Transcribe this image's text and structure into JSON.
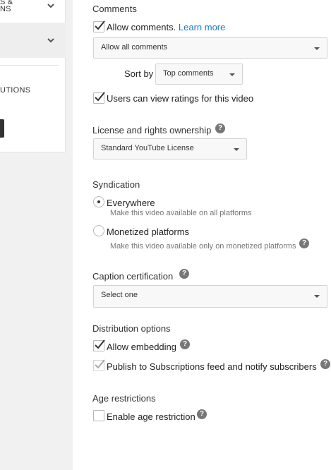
{
  "sidebar": {
    "row1_text_line1": "S &",
    "row1_text_line2": "NS",
    "contributions_label": "UTIONS",
    "icons": [
      "chevron-down-icon",
      "chevron-down-icon"
    ]
  },
  "comments": {
    "title": "Comments",
    "allow_label": "Allow comments.",
    "learn_more": "Learn more",
    "allow_checked": true,
    "filter_value": "Allow all comments",
    "sort_label": "Sort by",
    "sort_value": "Top comments",
    "ratings_label": "Users can view ratings for this video",
    "ratings_checked": true
  },
  "license": {
    "title": "License and rights ownership",
    "value": "Standard YouTube License"
  },
  "syndication": {
    "title": "Syndication",
    "options": [
      {
        "label": "Everywhere",
        "desc": "Make this video available on all platforms",
        "selected": true
      },
      {
        "label": "Monetized platforms",
        "desc": "Make this video available only on monetized platforms",
        "selected": false
      }
    ]
  },
  "caption": {
    "title": "Caption certification",
    "value": "Select one"
  },
  "distribution": {
    "title": "Distribution options",
    "embed_label": "Allow embedding",
    "embed_checked": true,
    "publish_label": "Publish to Subscriptions feed and notify subscribers",
    "publish_checked": true
  },
  "age": {
    "title": "Age restrictions",
    "label": "Enable age restriction",
    "checked": false
  },
  "help_glyph": "?",
  "colors": {
    "link": "#167ac6",
    "help_icon": "#777777",
    "panel_bg": "#ffffff",
    "page_bg": "#f1f1f1"
  }
}
